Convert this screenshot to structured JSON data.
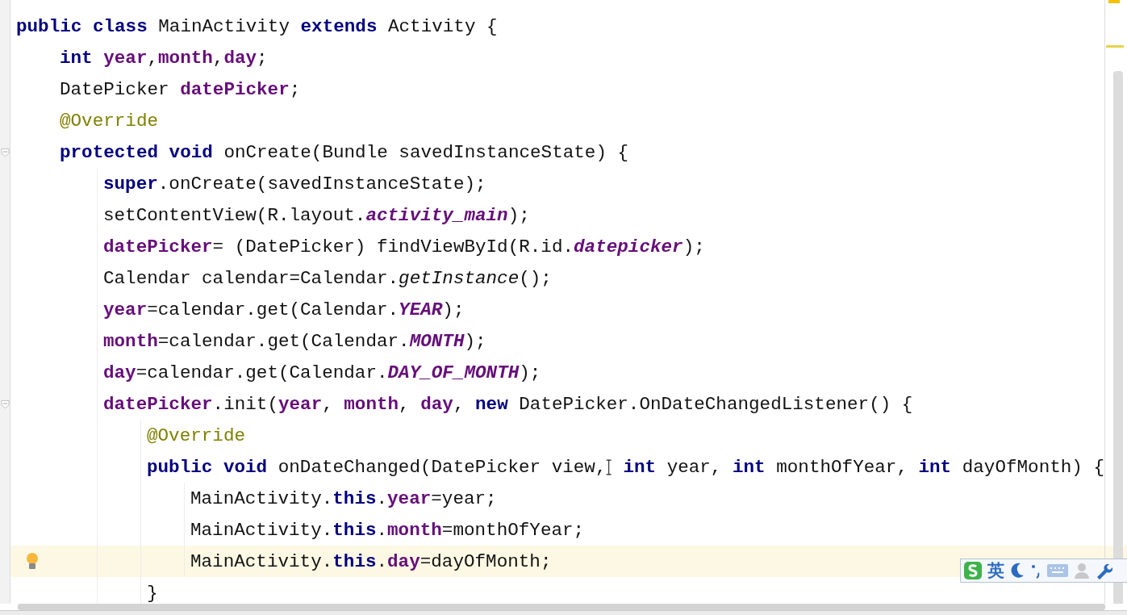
{
  "editor": {
    "lines": [
      {
        "tokens": [
          {
            "kind": "kw",
            "text": "public class "
          },
          {
            "kind": "plain",
            "text": "MainActivity "
          },
          {
            "kind": "kw",
            "text": "extends "
          },
          {
            "kind": "plain",
            "text": "Activity {"
          }
        ],
        "children": [
          {
            "tokens": [
              {
                "kind": "kw",
                "text": "int "
              },
              {
                "kind": "field",
                "text": "year"
              },
              {
                "kind": "plain",
                "text": ","
              },
              {
                "kind": "field",
                "text": "month"
              },
              {
                "kind": "plain",
                "text": ","
              },
              {
                "kind": "field",
                "text": "day"
              },
              {
                "kind": "plain",
                "text": ";"
              }
            ]
          },
          {
            "tokens": [
              {
                "kind": "plain",
                "text": "DatePicker "
              },
              {
                "kind": "field",
                "text": "datePicker"
              },
              {
                "kind": "plain",
                "text": ";"
              }
            ]
          },
          {
            "tokens": [
              {
                "kind": "ann",
                "text": "@Override"
              }
            ]
          },
          {
            "foldable": true,
            "tokens": [
              {
                "kind": "kw",
                "text": "protected void "
              },
              {
                "kind": "plain",
                "text": "onCreate(Bundle savedInstanceState) {"
              }
            ],
            "children": [
              {
                "tokens": [
                  {
                    "kind": "kw",
                    "text": "super"
                  },
                  {
                    "kind": "plain",
                    "text": ".onCreate(savedInstanceState);"
                  }
                ]
              },
              {
                "tokens": [
                  {
                    "kind": "plain",
                    "text": "setContentView(R.layout."
                  },
                  {
                    "kind": "const",
                    "text": "activity_main"
                  },
                  {
                    "kind": "plain",
                    "text": ");"
                  }
                ]
              },
              {
                "tokens": [
                  {
                    "kind": "field",
                    "text": "datePicker"
                  },
                  {
                    "kind": "plain",
                    "text": "= (DatePicker) findViewById(R.id."
                  },
                  {
                    "kind": "const",
                    "text": "datepicker"
                  },
                  {
                    "kind": "plain",
                    "text": ");"
                  }
                ]
              },
              {
                "tokens": [
                  {
                    "kind": "plain",
                    "text": "Calendar calendar=Calendar."
                  },
                  {
                    "kind": "static",
                    "text": "getInstance"
                  },
                  {
                    "kind": "plain",
                    "text": "();"
                  }
                ]
              },
              {
                "tokens": [
                  {
                    "kind": "field",
                    "text": "year"
                  },
                  {
                    "kind": "plain",
                    "text": "=calendar.get(Calendar."
                  },
                  {
                    "kind": "const",
                    "text": "YEAR"
                  },
                  {
                    "kind": "plain",
                    "text": ");"
                  }
                ]
              },
              {
                "tokens": [
                  {
                    "kind": "field",
                    "text": "month"
                  },
                  {
                    "kind": "plain",
                    "text": "=calendar.get(Calendar."
                  },
                  {
                    "kind": "const",
                    "text": "MONTH"
                  },
                  {
                    "kind": "plain",
                    "text": ");"
                  }
                ]
              },
              {
                "tokens": [
                  {
                    "kind": "field",
                    "text": "day"
                  },
                  {
                    "kind": "plain",
                    "text": "=calendar.get(Calendar."
                  },
                  {
                    "kind": "const",
                    "text": "DAY_OF_MONTH"
                  },
                  {
                    "kind": "plain",
                    "text": ");"
                  }
                ]
              },
              {
                "foldable": true,
                "tokens": [
                  {
                    "kind": "field",
                    "text": "datePicker"
                  },
                  {
                    "kind": "plain",
                    "text": ".init("
                  },
                  {
                    "kind": "field",
                    "text": "year"
                  },
                  {
                    "kind": "plain",
                    "text": ", "
                  },
                  {
                    "kind": "field",
                    "text": "month"
                  },
                  {
                    "kind": "plain",
                    "text": ", "
                  },
                  {
                    "kind": "field",
                    "text": "day"
                  },
                  {
                    "kind": "plain",
                    "text": ", "
                  },
                  {
                    "kind": "kw",
                    "text": "new "
                  },
                  {
                    "kind": "plain",
                    "text": "DatePicker.OnDateChangedListener() {"
                  }
                ],
                "children": [
                  {
                    "tokens": [
                      {
                        "kind": "ann",
                        "text": "@Override"
                      }
                    ]
                  },
                  {
                    "tokens": [
                      {
                        "kind": "kw",
                        "text": "public void "
                      },
                      {
                        "kind": "plain",
                        "text": "onDateChanged(DatePicker view,"
                      },
                      {
                        "kind": "ibeam"
                      },
                      {
                        "kind": "kw",
                        "text": " int "
                      },
                      {
                        "kind": "plain",
                        "text": "year, "
                      },
                      {
                        "kind": "kw",
                        "text": "int "
                      },
                      {
                        "kind": "plain",
                        "text": "monthOfYear, "
                      },
                      {
                        "kind": "kw",
                        "text": "int "
                      },
                      {
                        "kind": "plain",
                        "text": "dayOfMonth) {"
                      }
                    ],
                    "children": [
                      {
                        "tokens": [
                          {
                            "kind": "plain",
                            "text": "MainActivity."
                          },
                          {
                            "kind": "kw",
                            "text": "this"
                          },
                          {
                            "kind": "plain",
                            "text": "."
                          },
                          {
                            "kind": "field",
                            "text": "year"
                          },
                          {
                            "kind": "plain",
                            "text": "=year;"
                          }
                        ]
                      },
                      {
                        "tokens": [
                          {
                            "kind": "plain",
                            "text": "MainActivity."
                          },
                          {
                            "kind": "kw",
                            "text": "this"
                          },
                          {
                            "kind": "plain",
                            "text": "."
                          },
                          {
                            "kind": "field",
                            "text": "month"
                          },
                          {
                            "kind": "plain",
                            "text": "=monthOfYear;"
                          }
                        ]
                      },
                      {
                        "current": true,
                        "tokens": [
                          {
                            "kind": "plain",
                            "text": "MainActivity."
                          },
                          {
                            "kind": "kw",
                            "text": "this"
                          },
                          {
                            "kind": "plain",
                            "text": "."
                          },
                          {
                            "kind": "field",
                            "text": "day"
                          },
                          {
                            "kind": "plain",
                            "text": "=dayOfMonth;"
                          }
                        ]
                      }
                    ]
                  },
                  {
                    "tokens": [
                      {
                        "kind": "plain",
                        "text": "}"
                      }
                    ]
                  }
                ]
              }
            ]
          }
        ]
      }
    ]
  },
  "ime_toolbar": {
    "language": "英"
  }
}
